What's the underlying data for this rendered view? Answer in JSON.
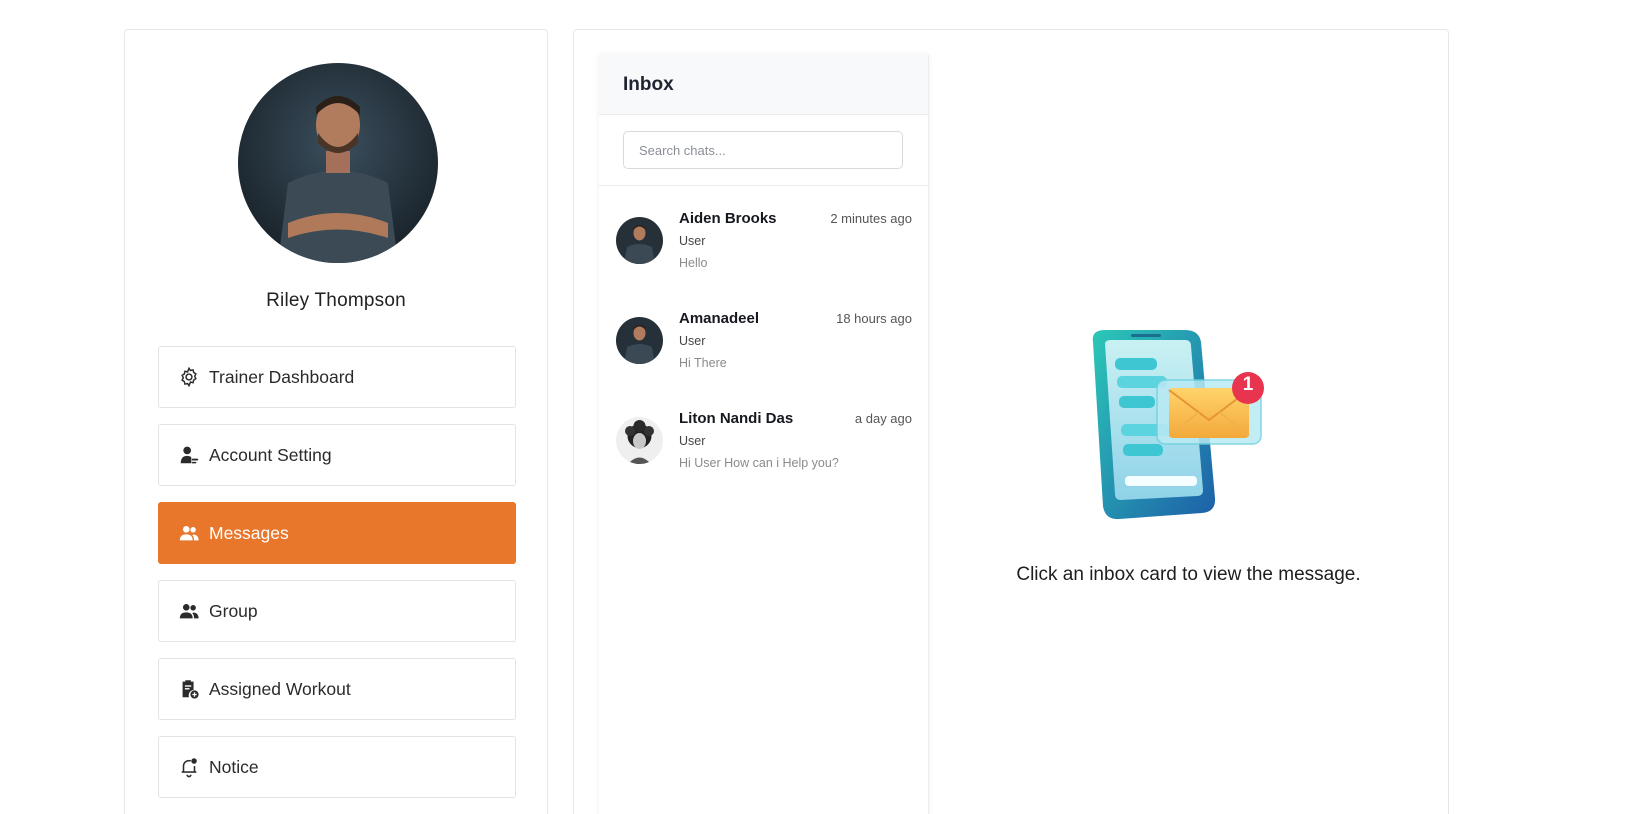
{
  "profile": {
    "name": "Riley Thompson",
    "avatar_icon": "trainer-portrait"
  },
  "menu": {
    "items": [
      {
        "label": "Trainer Dashboard",
        "icon": "gear-icon",
        "active": false
      },
      {
        "label": "Account Setting",
        "icon": "user-settings-icon",
        "active": false
      },
      {
        "label": "Messages",
        "icon": "users-icon",
        "active": true
      },
      {
        "label": "Group",
        "icon": "users-icon",
        "active": false
      },
      {
        "label": "Assigned Workout",
        "icon": "clipboard-add-icon",
        "active": false
      },
      {
        "label": "Notice",
        "icon": "bell-icon",
        "active": false
      }
    ]
  },
  "inbox": {
    "title": "Inbox",
    "search_placeholder": "Search chats...",
    "chats": [
      {
        "name": "Aiden Brooks",
        "time": "2 minutes ago",
        "role": "User",
        "preview": "Hello"
      },
      {
        "name": "Amanadeel",
        "time": "18 hours ago",
        "role": "User",
        "preview": "Hi There"
      },
      {
        "name": "Liton Nandi Das",
        "time": "a day ago",
        "role": "User",
        "preview": "Hi User How can i Help you?"
      }
    ]
  },
  "empty_state": {
    "message": "Click an inbox card to view the message.",
    "badge_count": "1"
  },
  "colors": {
    "accent": "#e8762b",
    "badge": "#e8344e"
  }
}
